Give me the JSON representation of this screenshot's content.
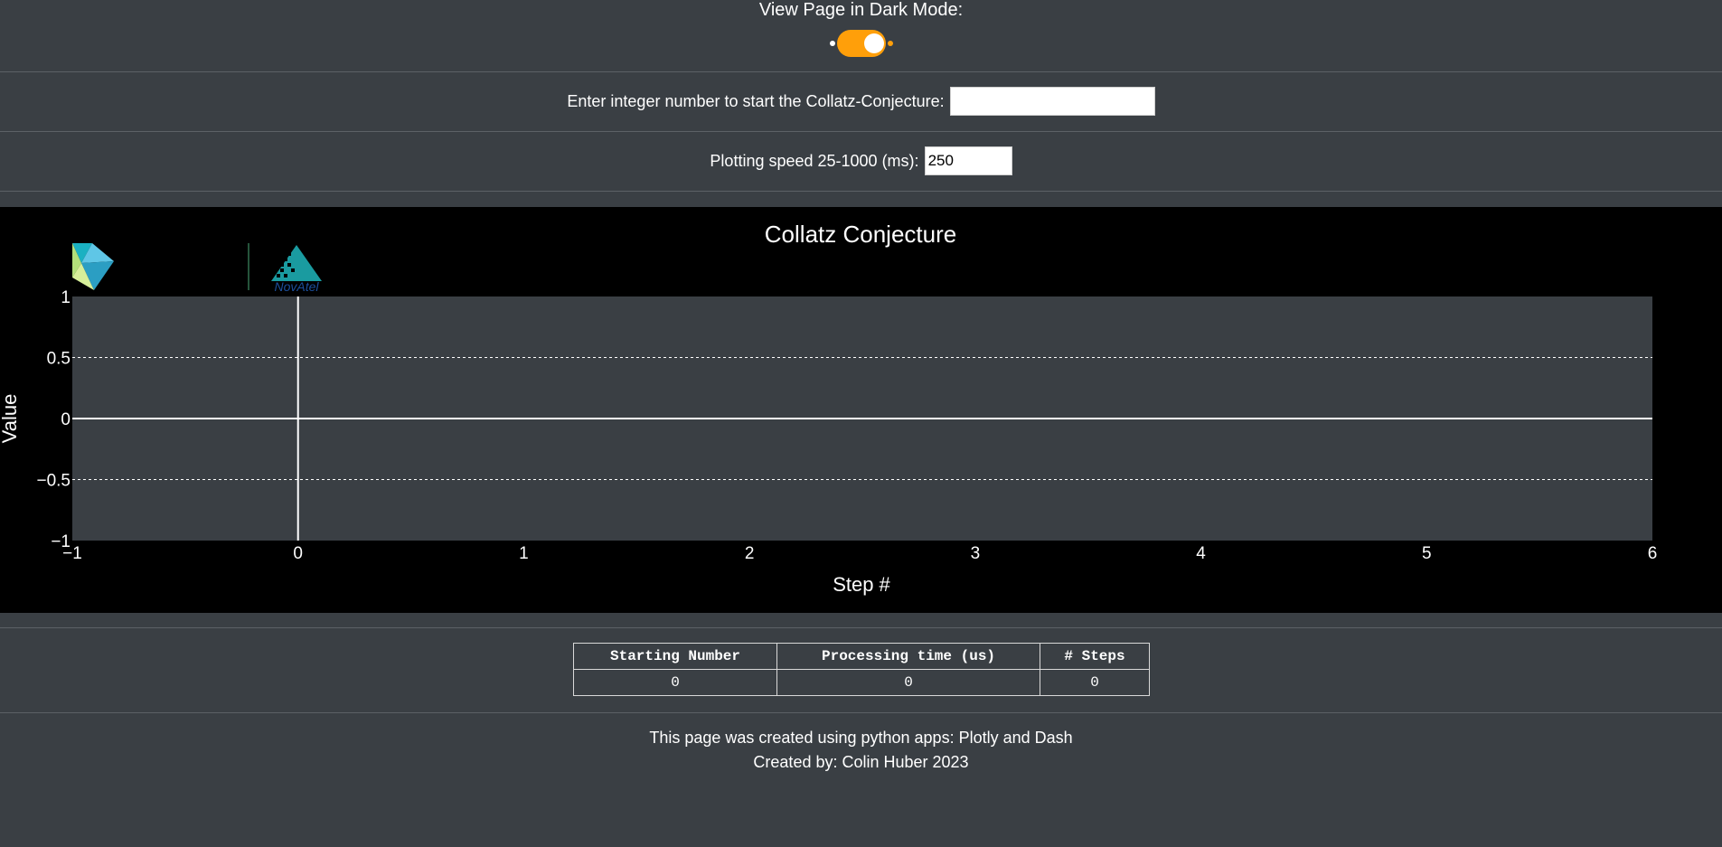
{
  "dark_mode": {
    "label": "View Page in Dark Mode:",
    "enabled": true,
    "accent_color": "#ff9f0a"
  },
  "start_input": {
    "label": "Enter integer number to start the Collatz-Conjecture:",
    "value": ""
  },
  "speed_input": {
    "label": "Plotting speed 25-1000 (ms):",
    "value": "250"
  },
  "logos": {
    "left_icon": "hexagon-logo-icon",
    "right_icon": "novatel-logo-icon",
    "right_text": "NovAtel"
  },
  "chart_data": {
    "type": "line",
    "title": "Collatz Conjecture",
    "xlabel": "Step #",
    "ylabel": "Value",
    "xlim": [
      -1,
      6
    ],
    "ylim": [
      -1,
      1
    ],
    "x_ticks": [
      "−1",
      "0",
      "1",
      "2",
      "3",
      "4",
      "5",
      "6"
    ],
    "y_ticks": [
      "−1",
      "−0.5",
      "0",
      "0.5",
      "1"
    ],
    "series": [
      {
        "x": [],
        "y": []
      }
    ],
    "grid": true,
    "plot_bg": "#3a3f44",
    "paper_bg": "#000000"
  },
  "results_table": {
    "headers": [
      "Starting Number",
      "Processing time (us)",
      "# Steps"
    ],
    "rows": [
      [
        "0",
        "0",
        "0"
      ]
    ]
  },
  "footer": {
    "line1": "This page was created using python apps: Plotly and Dash",
    "line2": "Created by: Colin Huber 2023"
  }
}
